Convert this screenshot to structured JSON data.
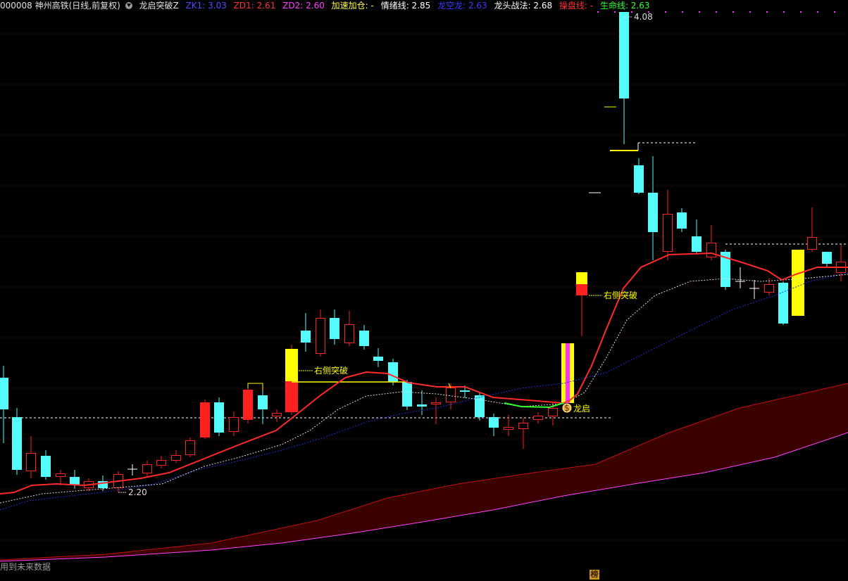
{
  "header": {
    "stock_title": "000008 神州高铁(日线,前复权)",
    "indicator_name": "龙启突破Z",
    "items": [
      {
        "label": "ZK1: 3.03",
        "color": "#4b4bff"
      },
      {
        "label": "ZD1: 2.61",
        "color": "#ff3030"
      },
      {
        "label": "ZD2: 2.60",
        "color": "#ff40ff"
      },
      {
        "label": "加速加仓: -",
        "color": "#ffff40"
      },
      {
        "label": "情绪线: 2.85",
        "color": "#ffffff"
      },
      {
        "label": "龙空龙: 2.63",
        "color": "#3a3aff"
      },
      {
        "label": "龙头战法: 2.68",
        "color": "#ffffff"
      },
      {
        "label": "操盘线: -",
        "color": "#ff3030"
      },
      {
        "label": "生命线: 2.63",
        "color": "#30ff30"
      }
    ]
  },
  "annotations": {
    "high_label": "4.08",
    "low_label": "2.20",
    "breakout_1": "右侧突破",
    "breakout_2": "右侧突破",
    "signal_label": "龙启",
    "coin_symbol": "$"
  },
  "footer": {
    "note": "用到未来数据",
    "badge": "榜"
  },
  "colors": {
    "up": "#ff2020",
    "down": "#54fcfc",
    "grid": "#8a0000",
    "ma_red": "#ff2a2a",
    "ma_white": "#dddddd",
    "ma_blue": "#1c2fd0",
    "band_fill": "#3a0000",
    "band_top": "#c01010",
    "band_bottom": "#ff44ff",
    "signal_yellow": "#ffff00",
    "signal_magenta": "#ff30ff"
  }
}
